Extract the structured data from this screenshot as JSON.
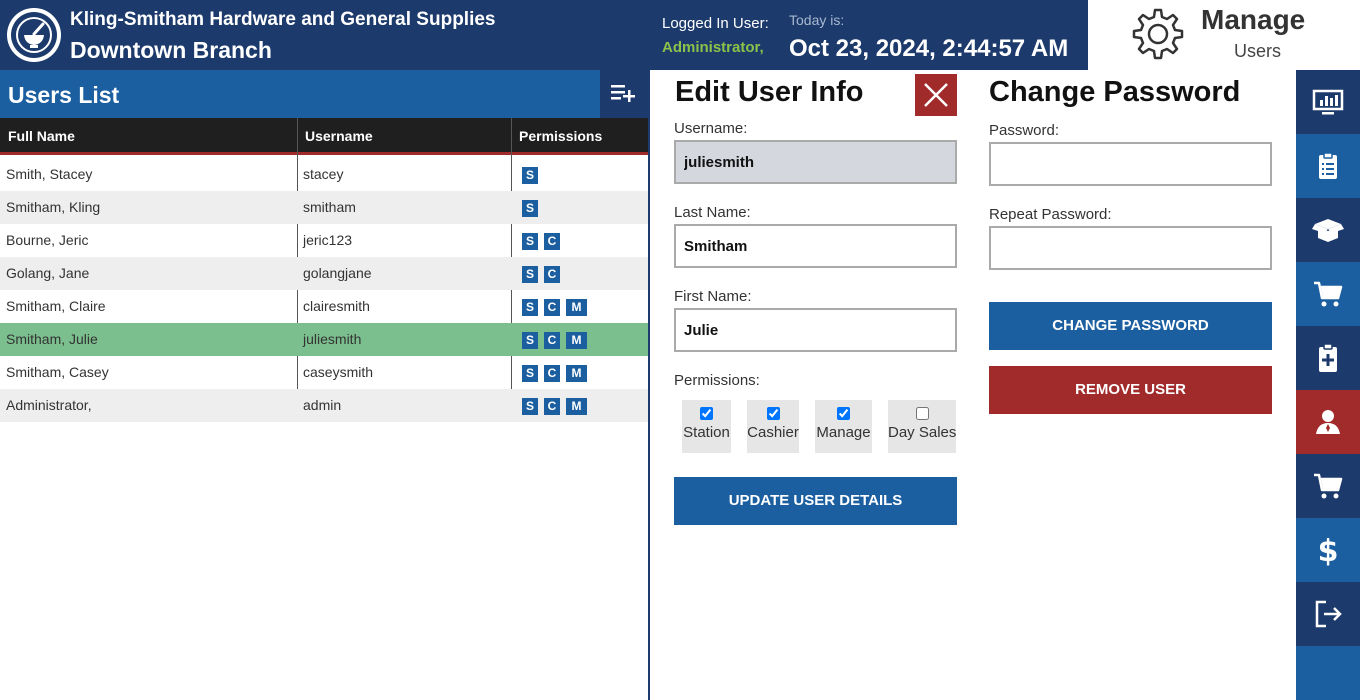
{
  "header": {
    "company": "Kling-Smitham Hardware and General Supplies",
    "branch": "Downtown Branch",
    "logged_in_label": "Logged In User:",
    "logged_in_user": "Administrator,",
    "today_label": "Today is:",
    "today_value": "Oct 23, 2024, 2:44:57 AM",
    "module_title": "Manage",
    "module_sub": "Users"
  },
  "users_list": {
    "title": "Users List",
    "columns": [
      "Full Name",
      "Username",
      "Permissions"
    ],
    "rows": [
      {
        "name": "Smith, Stacey",
        "username": "stacey",
        "perms": [
          "S"
        ]
      },
      {
        "name": "Smitham, Kling",
        "username": "smitham",
        "perms": [
          "S"
        ]
      },
      {
        "name": "Bourne, Jeric",
        "username": "jeric123",
        "perms": [
          "S",
          "C"
        ]
      },
      {
        "name": "Golang, Jane",
        "username": "golangjane",
        "perms": [
          "S",
          "C"
        ]
      },
      {
        "name": "Smitham, Claire",
        "username": "clairesmith",
        "perms": [
          "S",
          "C",
          "M"
        ]
      },
      {
        "name": "Smitham, Julie",
        "username": "juliesmith",
        "perms": [
          "S",
          "C",
          "M"
        ]
      },
      {
        "name": "Smitham, Casey",
        "username": "caseysmith",
        "perms": [
          "S",
          "C",
          "M"
        ]
      },
      {
        "name": "Administrator,",
        "username": "admin",
        "perms": [
          "S",
          "C",
          "M"
        ]
      }
    ],
    "selected_index": 5
  },
  "edit_user": {
    "title": "Edit User Info",
    "username_label": "Username:",
    "username_value": "juliesmith",
    "last_name_label": "Last Name:",
    "last_name_value": "Smitham",
    "first_name_label": "First Name:",
    "first_name_value": "Julie",
    "permissions_label": "Permissions:",
    "permissions": [
      {
        "label": "Station",
        "checked": true
      },
      {
        "label": "Cashier",
        "checked": true
      },
      {
        "label": "Manage",
        "checked": true
      },
      {
        "label": "Day Sales",
        "checked": false
      }
    ],
    "update_button": "UPDATE USER DETAILS"
  },
  "change_password": {
    "title": "Change Password",
    "password_label": "Password:",
    "password_value": "",
    "repeat_label": "Repeat Password:",
    "repeat_value": "",
    "change_button": "CHANGE PASSWORD",
    "remove_button": "REMOVE USER"
  },
  "nav": [
    {
      "icon": "monitor-chart-icon",
      "active": false
    },
    {
      "icon": "clipboard-list-icon",
      "active": false
    },
    {
      "icon": "open-box-icon",
      "active": false
    },
    {
      "icon": "cart-icon",
      "active": false
    },
    {
      "icon": "clipboard-plus-icon",
      "active": false
    },
    {
      "icon": "user-manage-icon",
      "active": true
    },
    {
      "icon": "cart-icon",
      "active": false
    },
    {
      "icon": "dollar-icon",
      "active": false
    },
    {
      "icon": "logout-icon",
      "active": false
    }
  ],
  "colors": {
    "header_bg": "#1c3a6b",
    "primary": "#1c5fa0",
    "danger": "#a12a2a",
    "selected_row": "#7bbf8e",
    "logged_user": "#8bc34a"
  }
}
